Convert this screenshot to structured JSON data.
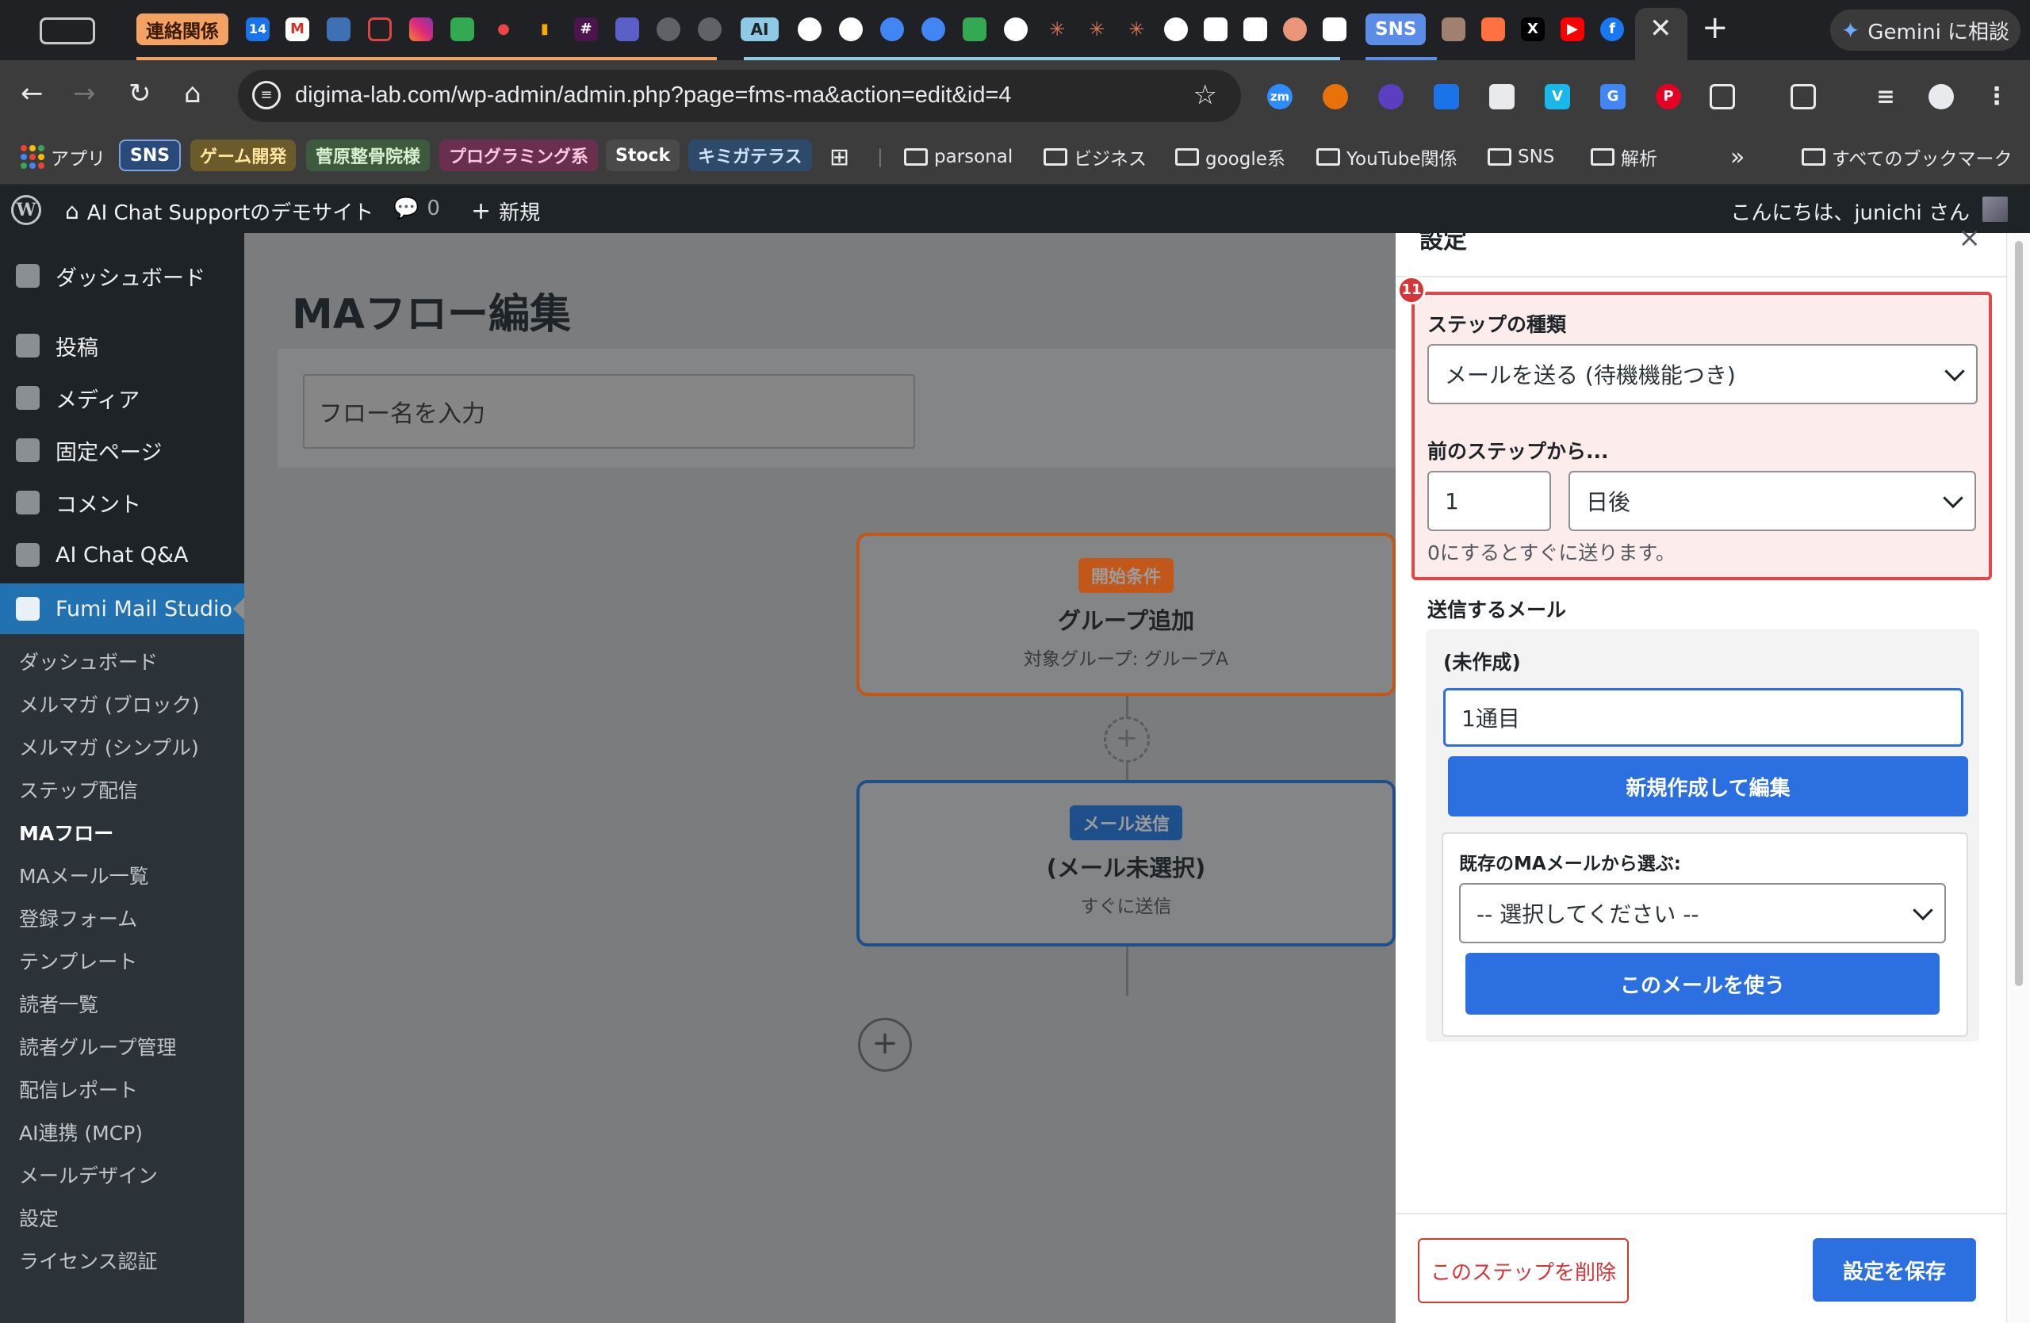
{
  "browser": {
    "tab_group_label": "連絡関係",
    "tab_group_color": "#f4a261",
    "favicon_calendar_day": "14",
    "favicon_gmail": "M",
    "favicon_ai": "AI",
    "sns_chip_label": "SNS",
    "sns_chip_color": "#5b8de6",
    "gemini_label": "Gemini に相談",
    "url": "digima-lab.com/wp-admin/admin.php?page=fms-ma&action=edit&id=4",
    "extension_zm": "zm",
    "bookmarks": {
      "apps": "アプリ",
      "chips": [
        {
          "label": "SNS",
          "color": "#2a4a7a",
          "text_color": "#ffffff"
        },
        {
          "label": "ゲーム開発",
          "color": "#6b5a2a",
          "text_color": "#ffe6a0"
        },
        {
          "label": "菅原整骨院様",
          "color": "#3e5a3e",
          "text_color": "#d8f0d0"
        },
        {
          "label": "プログラミング系",
          "color": "#6a2e4e",
          "text_color": "#ffc8e0"
        },
        {
          "label": "Stock",
          "color": "#4a4a4a",
          "text_color": "#ffffff"
        },
        {
          "label": "キミガテラス",
          "color": "#2e4a6a",
          "text_color": "#cfe3ff"
        }
      ],
      "folders": [
        "parsonal",
        "ビジネス",
        "google系",
        "YouTube関係",
        "SNS",
        "解析"
      ],
      "overflow": "»",
      "all_bookmarks": "すべてのブックマーク"
    }
  },
  "adminbar": {
    "site_name": "AI Chat Supportのデモサイト",
    "comments_count": "0",
    "new_label": "新規",
    "greeting": "こんにちは、junichi さん"
  },
  "sidebar": {
    "items": [
      {
        "label": "ダッシュボード"
      },
      {
        "label": "投稿"
      },
      {
        "label": "メディア"
      },
      {
        "label": "固定ページ"
      },
      {
        "label": "コメント"
      },
      {
        "label": "AI Chat Q&A"
      },
      {
        "label": "Fumi Mail Studio"
      }
    ],
    "submenu": [
      "ダッシュボード",
      "メルマガ (ブロック)",
      "メルマガ (シンプル)",
      "ステップ配信",
      "MAフロー",
      "MAメール一覧",
      "登録フォーム",
      "テンプレート",
      "読者一覧",
      "読者グループ管理",
      "配信レポート",
      "AI連携 (MCP)",
      "メールデザイン",
      "設定",
      "ライセンス認証"
    ],
    "active_color": "#2271b1"
  },
  "main": {
    "page_title": "MAフロー編集",
    "flow_name_placeholder": "フロー名を入力",
    "nodes": [
      {
        "badge": "開始条件",
        "title": "グループ追加",
        "sub": "対象グループ: グループA",
        "accent": "#c2571a"
      },
      {
        "badge": "メール送信",
        "title": "(メール未選択)",
        "sub": "すぐに送信",
        "accent": "#1f4f8a"
      }
    ],
    "add_icon": "+"
  },
  "panel": {
    "title": "設定",
    "close": "×",
    "highlight_badge": "11",
    "step_type_label": "ステップの種類",
    "step_type_value": "メールを送る (待機機能つき)",
    "delay_label": "前のステップから...",
    "delay_value": "1",
    "delay_unit": "日後",
    "delay_hint": "0にするとすぐに送ります。",
    "mail_section_label": "送信するメール",
    "draft_label": "(未作成)",
    "subject_value": "1通目",
    "create_button": "新規作成して編集",
    "existing_label": "既存のMAメールから選ぶ:",
    "existing_select": "-- 選択してください --",
    "use_button": "このメールを使う",
    "delete_button": "このステップを削除",
    "save_button": "設定を保存",
    "accent_color": "#2c6fe0",
    "danger_color": "#d63638"
  }
}
